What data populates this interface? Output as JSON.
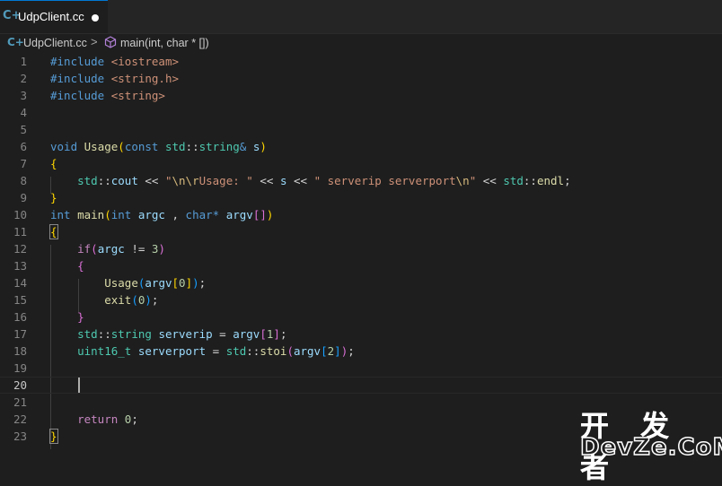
{
  "tab": {
    "label": "UdpClient.cc",
    "icon": "c-plus-plus-file-icon",
    "dirty": true
  },
  "breadcrumb": {
    "file": "UdpClient.cc",
    "separator": ">",
    "symbol": "main(int, char * [])"
  },
  "editor": {
    "active_line": 20,
    "line_numbers": [
      "1",
      "2",
      "3",
      "4",
      "5",
      "6",
      "7",
      "8",
      "9",
      "10",
      "11",
      "12",
      "13",
      "14",
      "15",
      "16",
      "17",
      "18",
      "19",
      "20",
      "21",
      "22",
      "23"
    ]
  },
  "watermark": {
    "text_cn": "开 发 者",
    "text_en": "DevZe.CoM"
  },
  "colors": {
    "background": "#1e1e1e",
    "keyword": "#569cd6",
    "string": "#ce9178",
    "type": "#4ec9b0",
    "function": "#dcdcaa",
    "variable": "#9cdcfe",
    "number": "#b5cea8",
    "control": "#c586c0",
    "bracket1": "#ffd700",
    "bracket2": "#da70d6",
    "bracket3": "#179fff",
    "tab_accent": "#0078d4"
  }
}
